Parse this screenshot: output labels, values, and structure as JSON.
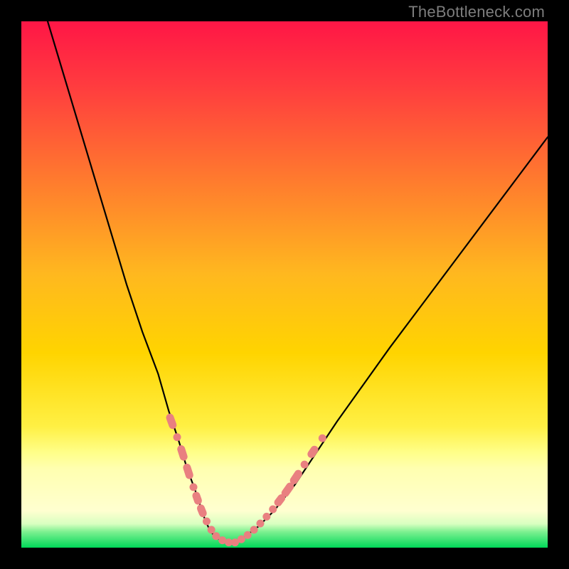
{
  "watermark": {
    "text": "TheBottleneck.com"
  },
  "colors": {
    "frame_bg": "#000000",
    "grad_top": "#ff1646",
    "grad_mid": "#ffd400",
    "grad_yellow_band": "#ffff8a",
    "grad_bottom": "#00e060",
    "curve": "#000000",
    "marker_fill": "#e98080",
    "marker_stroke": "#e98080"
  },
  "chart_data": {
    "type": "line",
    "title": "",
    "xlabel": "",
    "ylabel": "",
    "xlim": [
      0,
      100
    ],
    "ylim": [
      0,
      100
    ],
    "grid": false,
    "legend": false,
    "notes": "V-shaped bottleneck curve over red→yellow→green vertical gradient. Salmon markers cluster near the valley on both branches. No axis ticks or numeric labels are rendered in the image; values below are proportional estimates in 0–100 space.",
    "series": [
      {
        "name": "bottleneck-curve-left",
        "x": [
          5,
          8,
          11,
          14,
          17,
          20,
          23,
          26,
          28,
          30,
          31.5,
          33,
          34,
          35,
          36,
          37
        ],
        "y": [
          100,
          90,
          80,
          70,
          60,
          50,
          41,
          33,
          26,
          20,
          15,
          11,
          8,
          5,
          3,
          2
        ]
      },
      {
        "name": "bottleneck-curve-valley",
        "x": [
          37,
          38,
          39,
          40,
          41,
          42,
          43
        ],
        "y": [
          2,
          1.3,
          1,
          1,
          1.2,
          1.8,
          2.5
        ]
      },
      {
        "name": "bottleneck-curve-right",
        "x": [
          43,
          45,
          48,
          52,
          56,
          60,
          65,
          70,
          76,
          82,
          88,
          94,
          100
        ],
        "y": [
          2.5,
          4,
          7,
          12,
          18,
          24,
          31,
          38,
          46,
          54,
          62,
          70,
          78
        ]
      }
    ],
    "markers": [
      {
        "x": 28.5,
        "y": 24,
        "shape": "pill",
        "len": 3
      },
      {
        "x": 29.6,
        "y": 21,
        "shape": "dot"
      },
      {
        "x": 30.6,
        "y": 18,
        "shape": "pill",
        "len": 3
      },
      {
        "x": 31.7,
        "y": 14.5,
        "shape": "pill",
        "len": 3
      },
      {
        "x": 32.7,
        "y": 11.5,
        "shape": "dot"
      },
      {
        "x": 33.4,
        "y": 9.4,
        "shape": "pill",
        "len": 2.5
      },
      {
        "x": 34.3,
        "y": 7.0,
        "shape": "pill",
        "len": 2.5
      },
      {
        "x": 35.2,
        "y": 5.0,
        "shape": "dot"
      },
      {
        "x": 36.1,
        "y": 3.4,
        "shape": "dot"
      },
      {
        "x": 37.0,
        "y": 2.2,
        "shape": "dot"
      },
      {
        "x": 38.2,
        "y": 1.4,
        "shape": "dot"
      },
      {
        "x": 39.4,
        "y": 1.0,
        "shape": "dot"
      },
      {
        "x": 40.6,
        "y": 1.0,
        "shape": "dot"
      },
      {
        "x": 41.8,
        "y": 1.6,
        "shape": "dot"
      },
      {
        "x": 43.0,
        "y": 2.4,
        "shape": "dot"
      },
      {
        "x": 44.2,
        "y": 3.4,
        "shape": "dot"
      },
      {
        "x": 45.4,
        "y": 4.6,
        "shape": "dot"
      },
      {
        "x": 46.6,
        "y": 5.9,
        "shape": "dot"
      },
      {
        "x": 47.8,
        "y": 7.3,
        "shape": "dot"
      },
      {
        "x": 49.1,
        "y": 9.0,
        "shape": "pill",
        "len": 2.5
      },
      {
        "x": 50.6,
        "y": 11.0,
        "shape": "pill",
        "len": 3
      },
      {
        "x": 52.2,
        "y": 13.4,
        "shape": "pill",
        "len": 3
      },
      {
        "x": 53.8,
        "y": 15.8,
        "shape": "dot"
      },
      {
        "x": 55.4,
        "y": 18.2,
        "shape": "pill",
        "len": 2.5
      },
      {
        "x": 57.2,
        "y": 20.8,
        "shape": "dot"
      }
    ]
  }
}
